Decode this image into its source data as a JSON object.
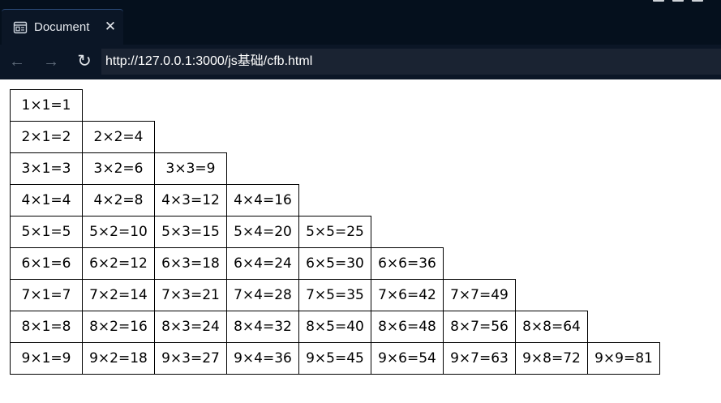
{
  "tab": {
    "title": "Document",
    "close_glyph": "✕",
    "icon": "page-icon"
  },
  "toolbar": {
    "back_glyph": "←",
    "forward_glyph": "→",
    "reload_glyph": "↻",
    "url": "http://127.0.0.1:3000/js基础/cfb.html"
  },
  "table": {
    "rows": [
      [
        "1×1=1"
      ],
      [
        "2×1=2",
        "2×2=4"
      ],
      [
        "3×1=3",
        "3×2=6",
        "3×3=9"
      ],
      [
        "4×1=4",
        "4×2=8",
        "4×3=12",
        "4×4=16"
      ],
      [
        "5×1=5",
        "5×2=10",
        "5×3=15",
        "5×4=20",
        "5×5=25"
      ],
      [
        "6×1=6",
        "6×2=12",
        "6×3=18",
        "6×4=24",
        "6×5=30",
        "6×6=36"
      ],
      [
        "7×1=7",
        "7×2=14",
        "7×3=21",
        "7×4=28",
        "7×5=35",
        "7×6=42",
        "7×7=49"
      ],
      [
        "8×1=8",
        "8×2=16",
        "8×3=24",
        "8×4=32",
        "8×5=40",
        "8×6=48",
        "8×7=56",
        "8×8=64"
      ],
      [
        "9×1=9",
        "9×2=18",
        "9×3=27",
        "9×4=36",
        "9×5=45",
        "9×6=54",
        "9×7=63",
        "9×8=72",
        "9×9=81"
      ]
    ]
  },
  "colors": {
    "chrome_background": "#0b1626",
    "tabstrip_background": "#05101d",
    "address_background": "#1a2332",
    "page_background": "#ffffff",
    "cell_border": "#000000"
  }
}
